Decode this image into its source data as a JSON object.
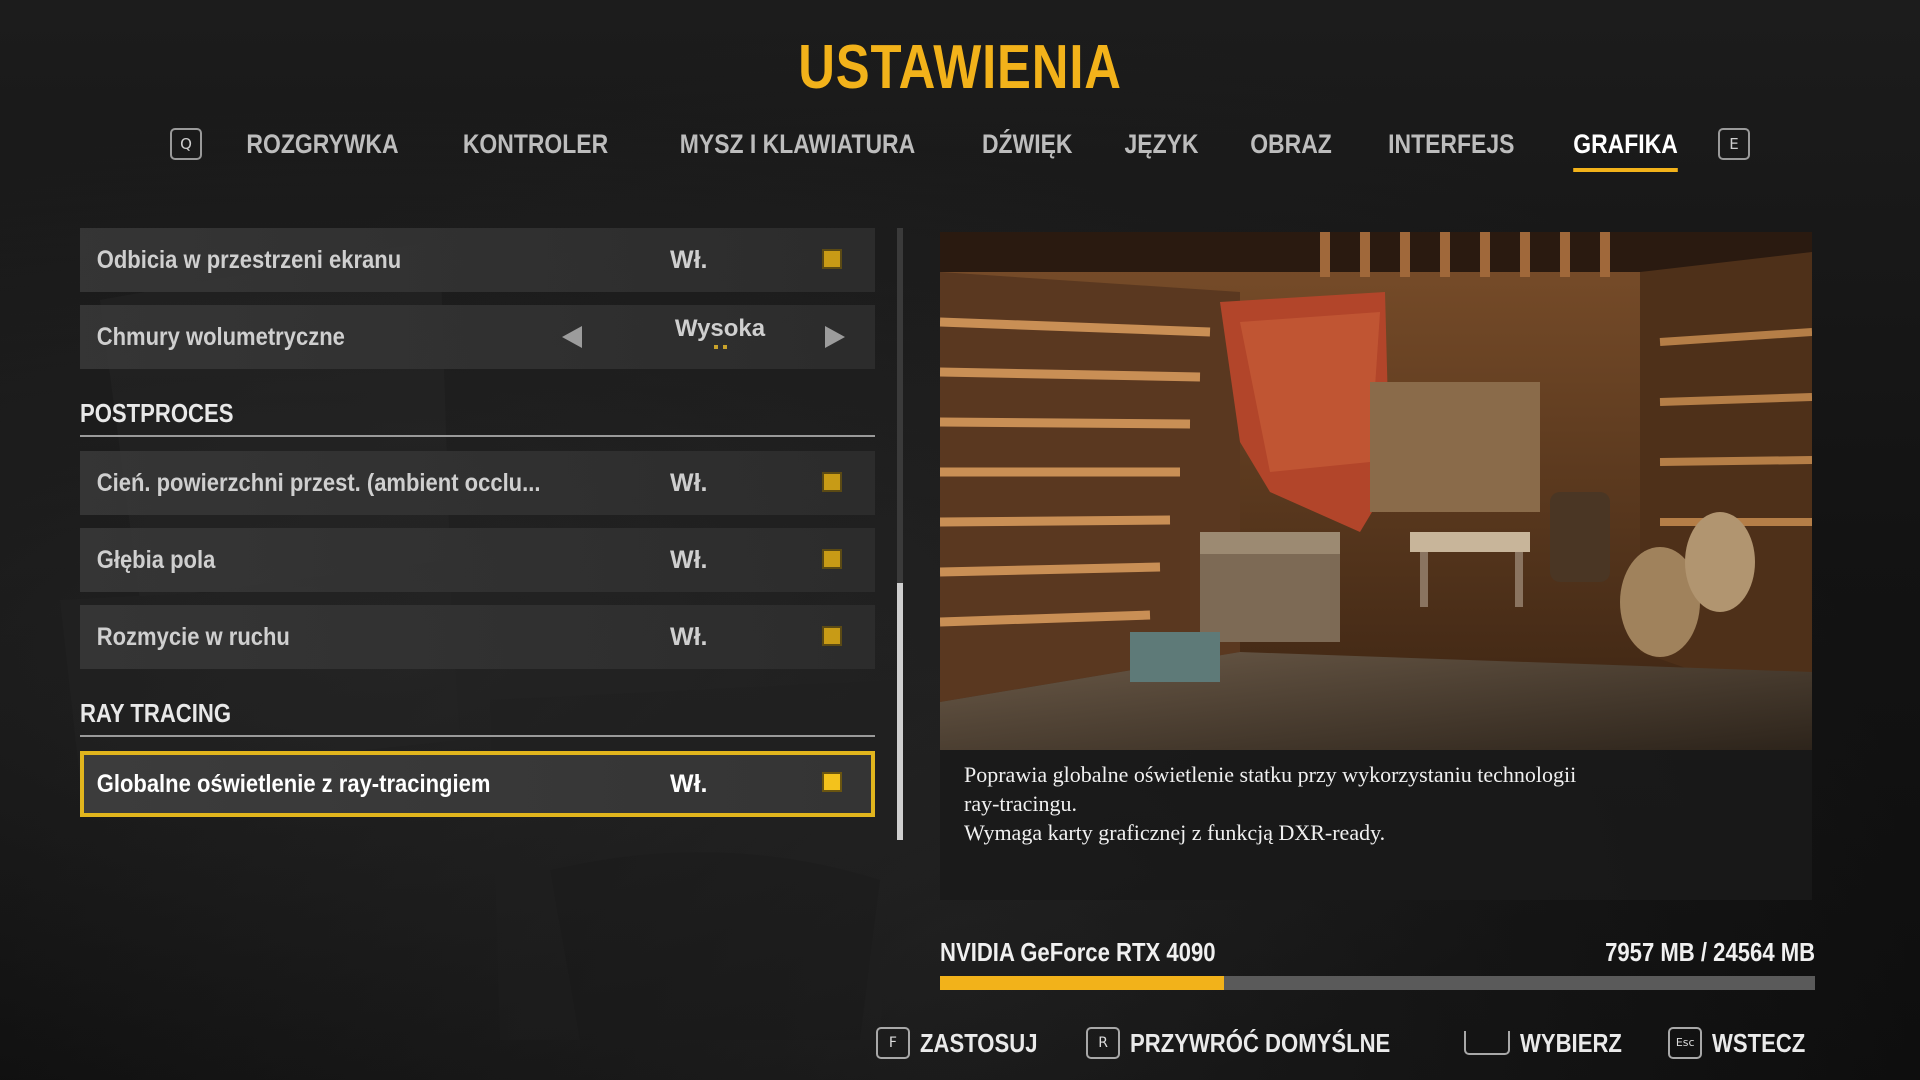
{
  "title": "USTAWIENIA",
  "tabs": {
    "prev_key": "Q",
    "next_key": "E",
    "items": [
      {
        "label": "ROZGRYWKA"
      },
      {
        "label": "KONTROLER"
      },
      {
        "label": "MYSZ I KLAWIATURA"
      },
      {
        "label": "DŹWIĘK"
      },
      {
        "label": "JĘZYK"
      },
      {
        "label": "OBRAZ"
      },
      {
        "label": "INTERFEJS"
      },
      {
        "label": "GRAFIKA"
      }
    ],
    "active": "GRAFIKA"
  },
  "settings": {
    "row1": {
      "label": "Odbicia w przestrzeni ekranu",
      "value": "Wł."
    },
    "row2": {
      "label": "Chmury wolumetryczne",
      "value": "Wysoka"
    },
    "section_post": "POSTPROCES",
    "row3": {
      "label": "Cień. powierzchni przest. (ambient occlu...",
      "value": "Wł."
    },
    "row4": {
      "label": "Głębia pola",
      "value": "Wł."
    },
    "row5": {
      "label": "Rozmycie w ruchu",
      "value": "Wł."
    },
    "section_rt": "RAY TRACING",
    "row6": {
      "label": "Globalne oświetlenie z ray-tracingiem",
      "value": "Wł."
    }
  },
  "description": {
    "line1": "Poprawia globalne oświetlenie statku przy wykorzystaniu technologii",
    "line2": "ray-tracingu.",
    "line3": "Wymaga karty graficznej z funkcją DXR-ready."
  },
  "gpu": {
    "name": "NVIDIA GeForce RTX 4090",
    "memory": "7957 MB / 24564 MB",
    "used_fraction": 0.324
  },
  "footer": {
    "apply": {
      "key": "F",
      "label": "ZASTOSUJ"
    },
    "reset": {
      "key": "R",
      "label": "PRZYWRÓĆ DOMYŚLNE"
    },
    "select": {
      "label": "WYBIERZ"
    },
    "back": {
      "key": "Esc",
      "label": "WSTECZ"
    }
  },
  "colors": {
    "accent": "#f2b21a",
    "text": "#d8d8d8",
    "panel": "#373737"
  }
}
